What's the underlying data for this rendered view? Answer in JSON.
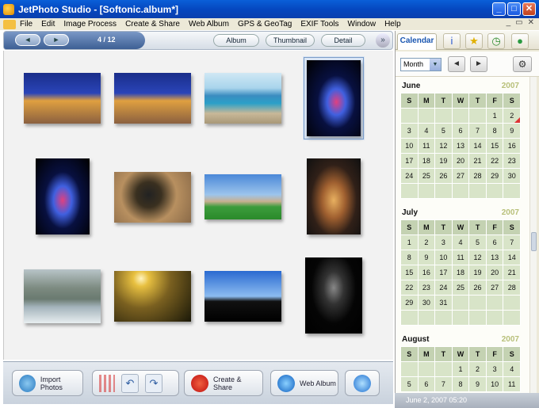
{
  "window": {
    "title": "JetPhoto Studio - [Softonic.album*]",
    "min": "_",
    "max": "□",
    "close": "✕"
  },
  "menu": [
    "File",
    "Edit",
    "Image Process",
    "Create & Share",
    "Web Album",
    "GPS & GeoTag",
    "EXIF Tools",
    "Window",
    "Help"
  ],
  "mdi": {
    "min": "_",
    "restore": "▭",
    "close": "✕"
  },
  "nav": {
    "prev": "◄",
    "next": "►",
    "page": "4 / 12"
  },
  "views": {
    "album": "Album",
    "thumbnail": "Thumbnail",
    "detail": "Detail",
    "more": "»"
  },
  "bottom": {
    "import": "Import Photos",
    "create": "Create & Share",
    "web": "Web Album"
  },
  "sidebar": {
    "tab": "Calendar",
    "view": "Month",
    "dd": "▼",
    "prev": "◄",
    "next": "►",
    "gear": "⚙",
    "tab_icons": [
      "i",
      "★",
      "◷",
      "●"
    ]
  },
  "calendar": [
    {
      "name": "June",
      "year": "2007",
      "days": [
        "S",
        "M",
        "T",
        "W",
        "T",
        "F",
        "S"
      ],
      "cells": [
        "",
        "",
        "",
        "",
        "",
        "1",
        "2",
        "3",
        "4",
        "5",
        "6",
        "7",
        "8",
        "9",
        "10",
        "11",
        "12",
        "13",
        "14",
        "15",
        "16",
        "17",
        "18",
        "19",
        "20",
        "21",
        "22",
        "23",
        "24",
        "25",
        "26",
        "27",
        "28",
        "29",
        "30",
        "",
        "",
        "",
        "",
        "",
        "",
        ""
      ],
      "flag": "2"
    },
    {
      "name": "July",
      "year": "2007",
      "days": [
        "S",
        "M",
        "T",
        "W",
        "T",
        "F",
        "S"
      ],
      "cells": [
        "1",
        "2",
        "3",
        "4",
        "5",
        "6",
        "7",
        "8",
        "9",
        "10",
        "11",
        "12",
        "13",
        "14",
        "15",
        "16",
        "17",
        "18",
        "19",
        "20",
        "21",
        "22",
        "23",
        "24",
        "25",
        "26",
        "27",
        "28",
        "29",
        "30",
        "31",
        "",
        "",
        "",
        "",
        "",
        "",
        "",
        "",
        "",
        "",
        ""
      ]
    },
    {
      "name": "August",
      "year": "2007",
      "days": [
        "S",
        "M",
        "T",
        "W",
        "T",
        "F",
        "S"
      ],
      "cells": [
        "",
        "",
        "",
        "1",
        "2",
        "3",
        "4",
        "5",
        "6",
        "7",
        "8",
        "9",
        "10",
        "11"
      ]
    }
  ],
  "status": "June 2, 2007 05:20"
}
